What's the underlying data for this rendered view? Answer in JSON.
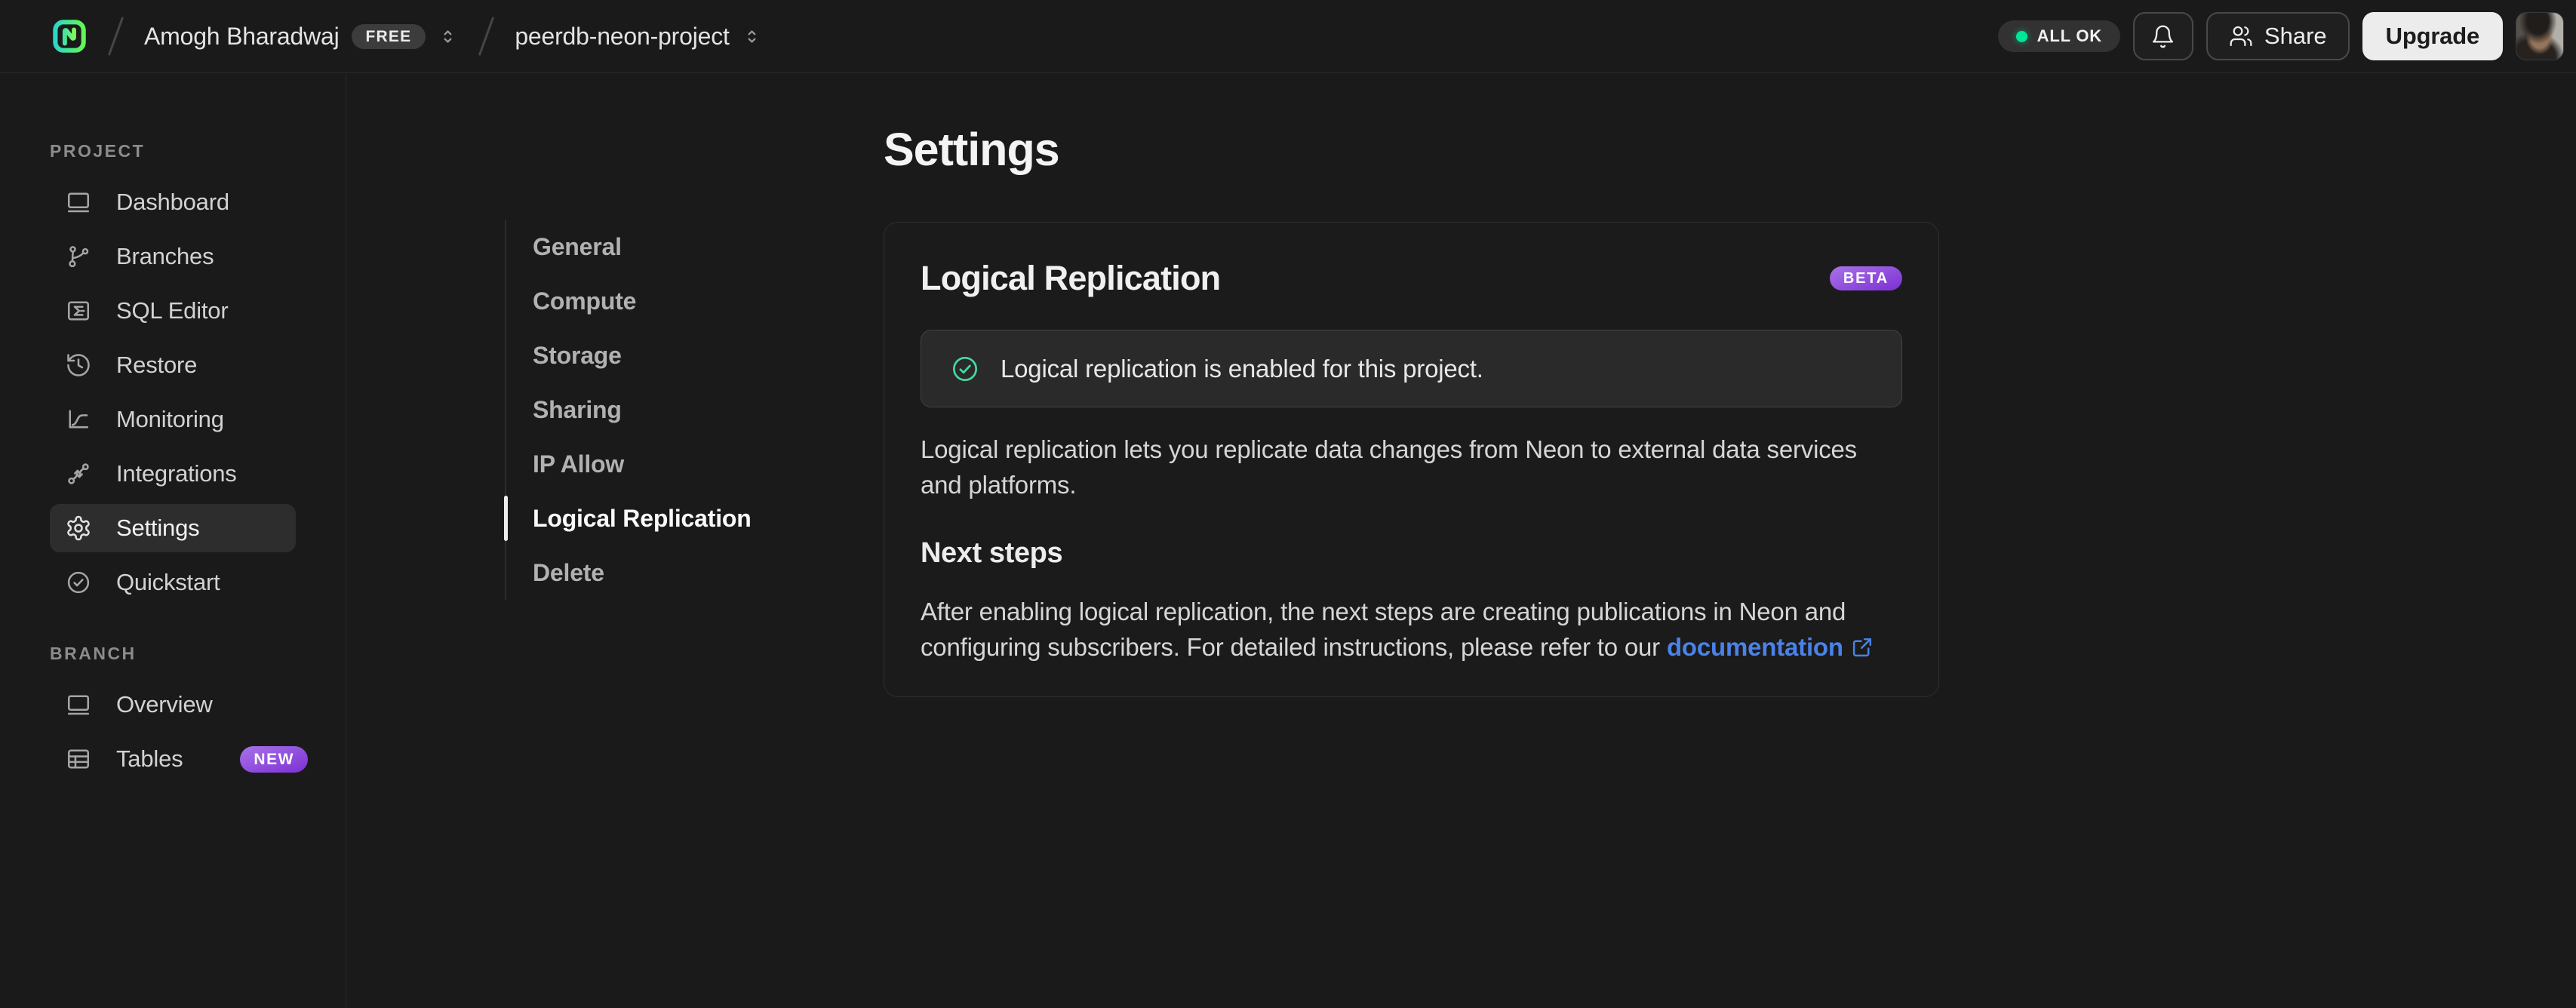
{
  "header": {
    "breadcrumb": {
      "org": "Amogh Bharadwaj",
      "org_badge": "FREE",
      "project": "peerdb-neon-project"
    },
    "status_label": "ALL OK",
    "share_label": "Share",
    "upgrade_label": "Upgrade"
  },
  "sidebar": {
    "sections": [
      {
        "label": "PROJECT",
        "items": [
          {
            "label": "Dashboard",
            "icon": "window-icon"
          },
          {
            "label": "Branches",
            "icon": "git-branch-icon"
          },
          {
            "label": "SQL Editor",
            "icon": "sql-terminal-icon"
          },
          {
            "label": "Restore",
            "icon": "history-icon"
          },
          {
            "label": "Monitoring",
            "icon": "chart-icon"
          },
          {
            "label": "Integrations",
            "icon": "integrations-icon"
          },
          {
            "label": "Settings",
            "icon": "gear-icon",
            "active": true
          },
          {
            "label": "Quickstart",
            "icon": "check-circle-icon"
          }
        ]
      },
      {
        "label": "BRANCH",
        "items": [
          {
            "label": "Overview",
            "icon": "window-icon"
          },
          {
            "label": "Tables",
            "icon": "table-icon",
            "badge": "NEW"
          }
        ]
      }
    ]
  },
  "settings_nav": {
    "items": [
      {
        "label": "General"
      },
      {
        "label": "Compute"
      },
      {
        "label": "Storage"
      },
      {
        "label": "Sharing"
      },
      {
        "label": "IP Allow"
      },
      {
        "label": "Logical Replication",
        "active": true
      },
      {
        "label": "Delete"
      }
    ]
  },
  "main": {
    "title": "Settings",
    "card": {
      "title": "Logical Replication",
      "badge": "BETA",
      "alert_text": "Logical replication is enabled for this project.",
      "description": "Logical replication lets you replicate data changes from Neon to external data services and platforms.",
      "next_steps_title": "Next steps",
      "next_steps_text": "After enabling logical replication, the next steps are creating publications in Neon and configuring subscribers. For detailed instructions, please refer to our ",
      "doc_link_label": "documentation"
    }
  },
  "colors": {
    "accent_green": "#00e599",
    "success_green": "#46d9a2",
    "link_blue": "#4a82e8",
    "badge_purple_start": "#a873e8",
    "badge_purple_end": "#7c2fd4"
  }
}
